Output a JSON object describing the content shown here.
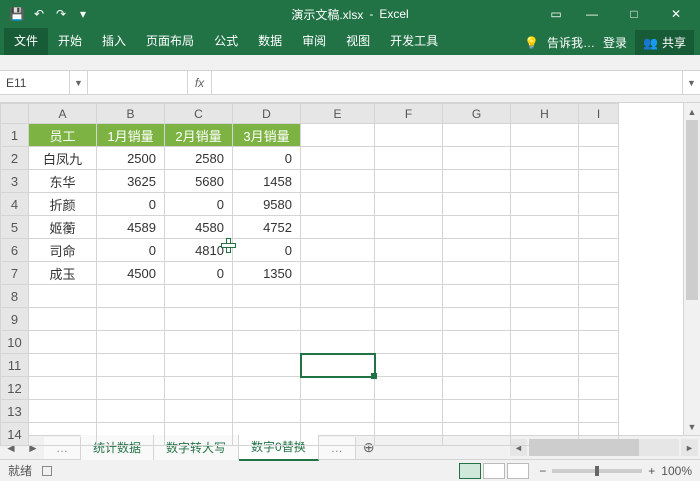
{
  "title": {
    "doc": "演示文稿.xlsx",
    "app": "Excel"
  },
  "qat": {
    "save": "💾",
    "undo": "↶",
    "redo": "↷",
    "more": "▾"
  },
  "win": {
    "ribbonopts": "▭",
    "min": "—",
    "max": "□",
    "close": "✕"
  },
  "tabs": {
    "file": "文件",
    "home": "开始",
    "insert": "插入",
    "layout": "页面布局",
    "formulas": "公式",
    "data": "数据",
    "review": "审阅",
    "view": "视图",
    "dev": "开发工具",
    "tell": "告诉我…",
    "login": "登录",
    "share": "共享"
  },
  "namebox": "E11",
  "fx": "fx",
  "columns": [
    "A",
    "B",
    "C",
    "D",
    "E",
    "F",
    "G",
    "H",
    "I"
  ],
  "row_count": 14,
  "headers": {
    "a": "员工",
    "b": "1月销量",
    "c": "2月销量",
    "d": "3月销量"
  },
  "rows": [
    {
      "name": "白凤九",
      "m1": "2500",
      "m2": "2580",
      "m3": "0"
    },
    {
      "name": "东华",
      "m1": "3625",
      "m2": "5680",
      "m3": "1458"
    },
    {
      "name": "折颜",
      "m1": "0",
      "m2": "0",
      "m3": "9580"
    },
    {
      "name": "姬蘅",
      "m1": "4589",
      "m2": "4580",
      "m3": "4752"
    },
    {
      "name": "司命",
      "m1": "0",
      "m2": "4810",
      "m3": "0"
    },
    {
      "name": "成玉",
      "m1": "4500",
      "m2": "0",
      "m3": "1350"
    }
  ],
  "sheets": {
    "s1": "统计数据",
    "s2": "数字转大写",
    "s3": "数字0替换",
    "more": "…",
    "add": "⊕"
  },
  "status": {
    "ready": "就绪",
    "zoom_out": "−",
    "zoom_in": "+",
    "zoom": "100%"
  }
}
